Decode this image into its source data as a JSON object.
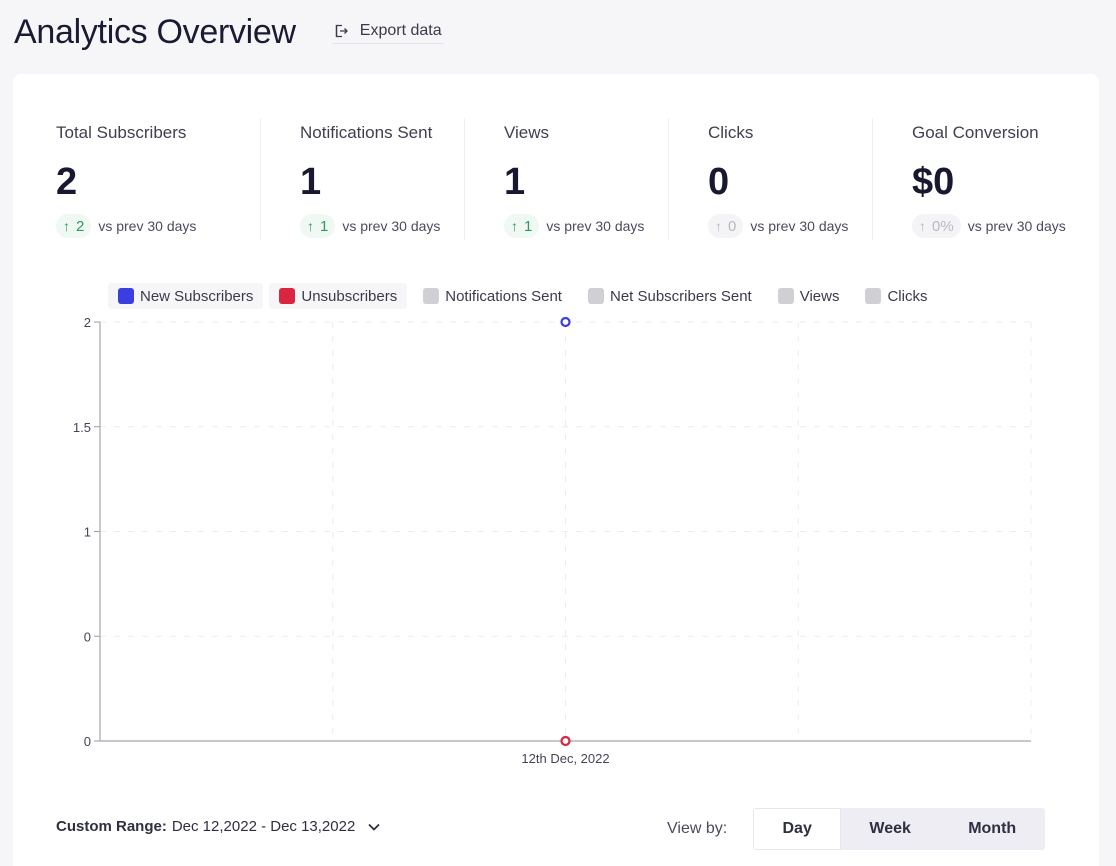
{
  "header": {
    "title": "Analytics Overview",
    "export_label": "Export data",
    "export_icon": "export-icon"
  },
  "stats": [
    {
      "label": "Total Subscribers",
      "value": "2",
      "change": "2",
      "trend": "up",
      "compare": "vs prev 30 days"
    },
    {
      "label": "Notifications Sent",
      "value": "1",
      "change": "1",
      "trend": "up",
      "compare": "vs prev 30 days"
    },
    {
      "label": "Views",
      "value": "1",
      "change": "1",
      "trend": "up",
      "compare": "vs prev 30 days"
    },
    {
      "label": "Clicks",
      "value": "0",
      "change": "0",
      "trend": "flat",
      "compare": "vs prev 30 days"
    },
    {
      "label": "Goal Conversion",
      "value": "$0",
      "change": "0%",
      "trend": "flat",
      "compare": "vs prev 30 days"
    }
  ],
  "colors": {
    "new_subscribers": "#3b3fe0",
    "unsubscribers": "#d9253f",
    "inactive": "#cfcfd4",
    "trend_up": "#2b9a5c",
    "trend_flat": "#b9b9c3"
  },
  "chart_data": {
    "type": "line",
    "title": "",
    "xlabel": "",
    "ylabel": "",
    "categories": [
      "12th Dec, 2022"
    ],
    "y_ticks": [
      "0",
      "0",
      "1",
      "1.5",
      "2"
    ],
    "ylim": [
      0,
      2
    ],
    "grid": true,
    "legend_position": "top",
    "legend": [
      {
        "name": "New Subscribers",
        "active": true,
        "color": "#3b3fe0"
      },
      {
        "name": "Unsubscribers",
        "active": true,
        "color": "#d9253f"
      },
      {
        "name": "Notifications Sent",
        "active": false,
        "color": "#cfcfd4"
      },
      {
        "name": "Net Subscribers Sent",
        "active": false,
        "color": "#cfcfd4"
      },
      {
        "name": "Views",
        "active": false,
        "color": "#cfcfd4"
      },
      {
        "name": "Clicks",
        "active": false,
        "color": "#cfcfd4"
      }
    ],
    "series": [
      {
        "name": "New Subscribers",
        "values": [
          2
        ],
        "color": "#3b3fe0"
      },
      {
        "name": "Unsubscribers",
        "values": [
          0
        ],
        "color": "#d9253f"
      }
    ]
  },
  "footer": {
    "range_label": "Custom Range:",
    "range_value": "Dec 12,2022 - Dec 13,2022",
    "view_by_label": "View by:",
    "view_options": [
      "Day",
      "Week",
      "Month"
    ],
    "view_selected": "Day"
  }
}
